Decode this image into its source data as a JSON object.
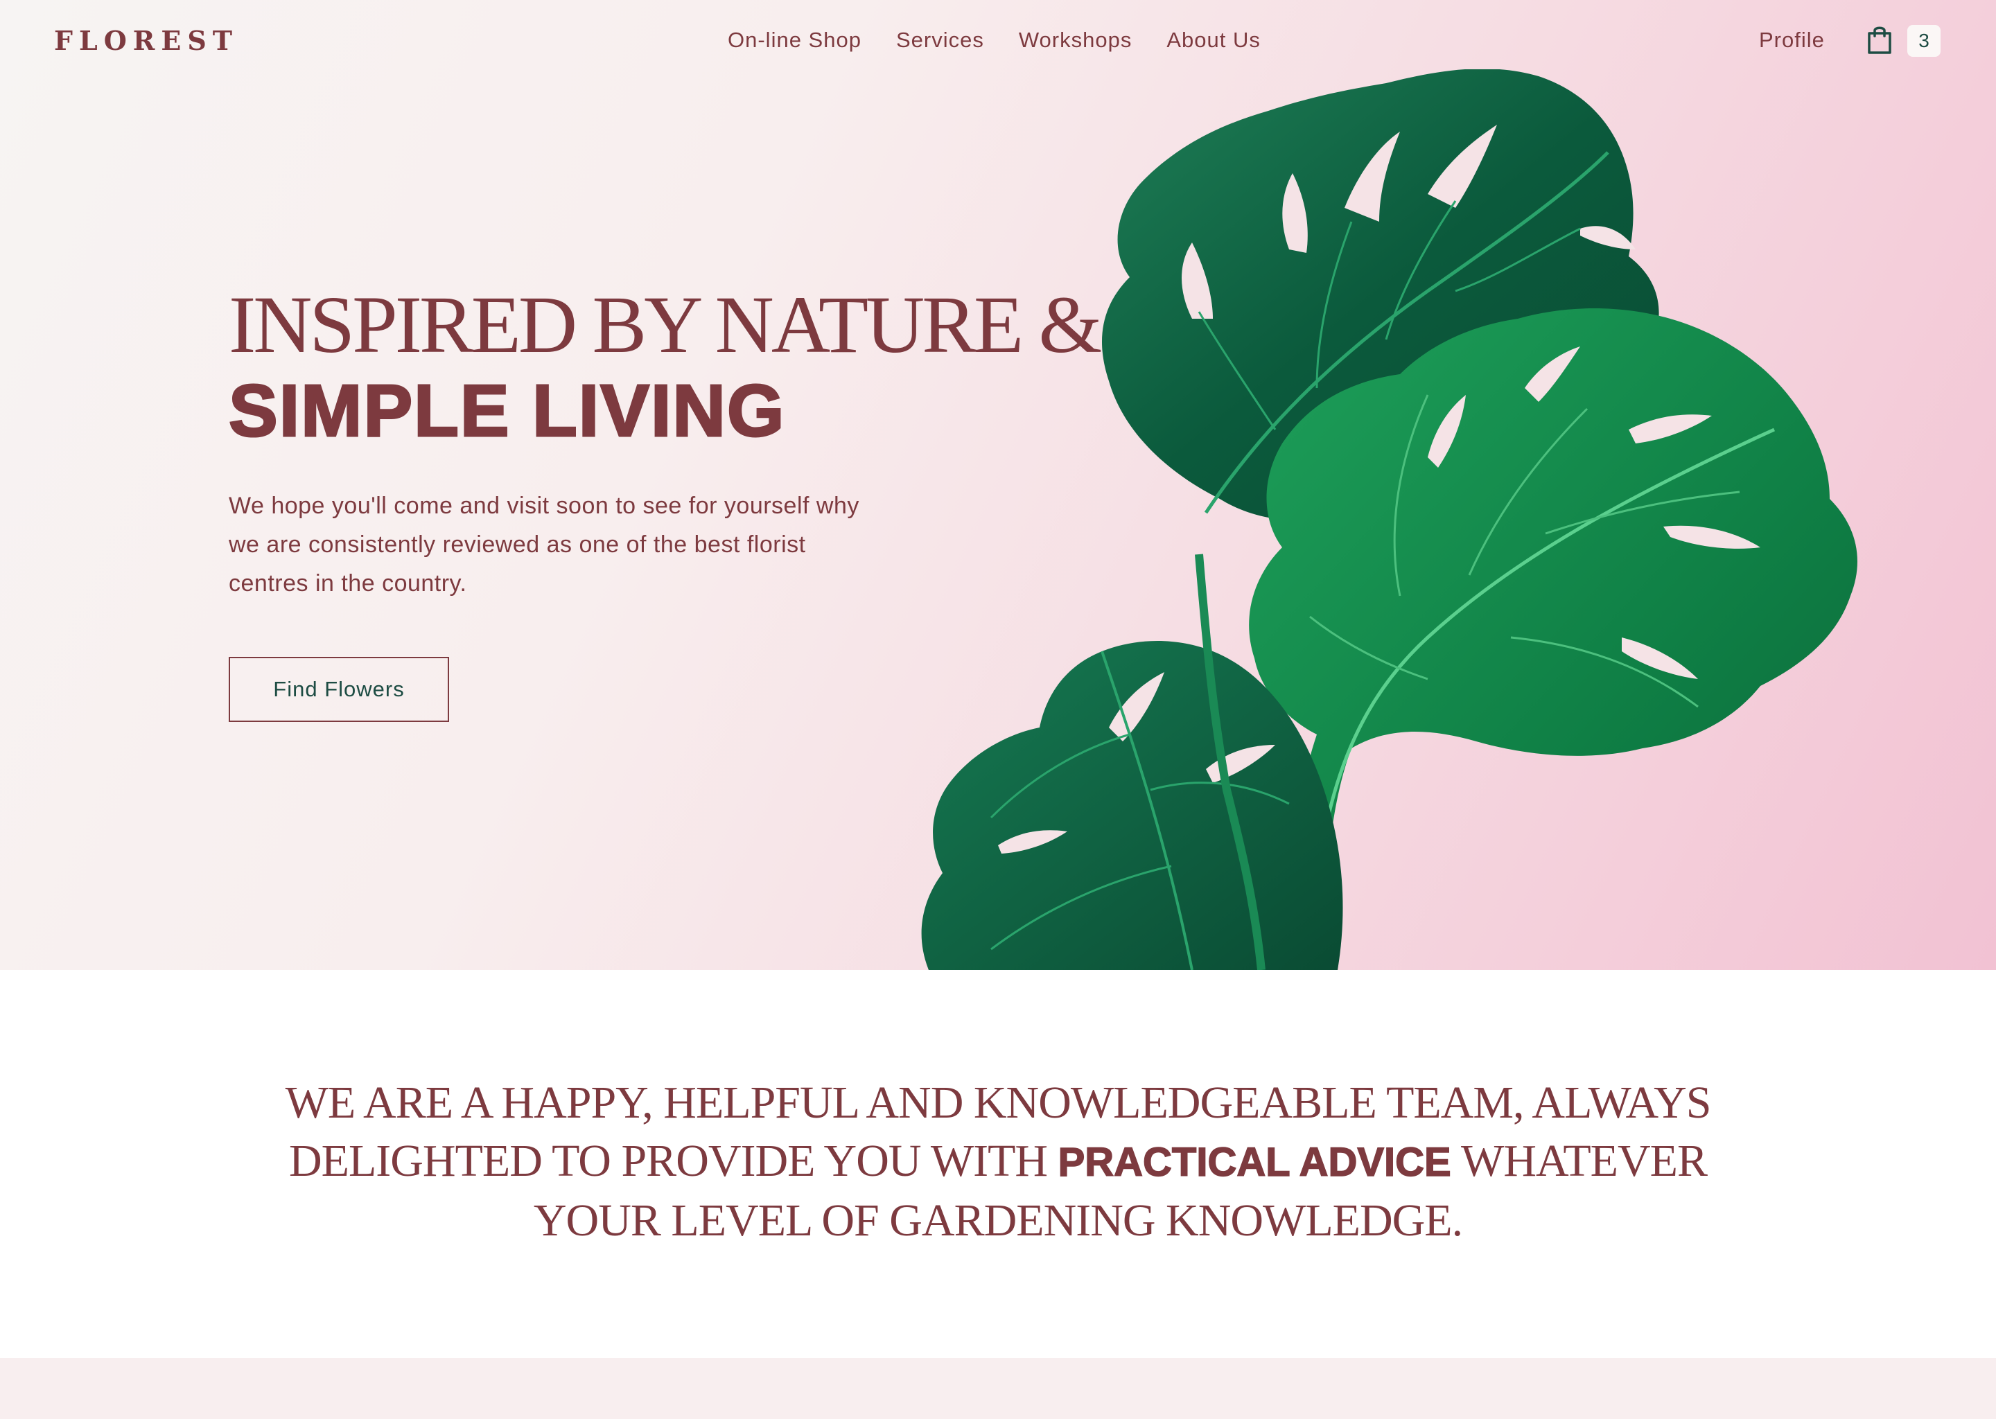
{
  "brand": {
    "logo": "FLOREST"
  },
  "nav": {
    "items": [
      {
        "label": "On-line Shop"
      },
      {
        "label": "Services"
      },
      {
        "label": "Workshops"
      },
      {
        "label": "About Us"
      }
    ],
    "profile_label": "Profile",
    "cart_icon": "shopping-bag-icon",
    "cart_count": "3"
  },
  "hero": {
    "title_line1": "INSPIRED BY NATURE &",
    "title_line2": "SIMPLE LIVING",
    "description": "We hope you'll come and visit soon to see for yourself why we are consistently reviewed as one of the best florist centres in the country.",
    "cta_label": "Find Flowers",
    "image": "monstera-leaves"
  },
  "mission": {
    "text_before": "WE ARE A HAPPY, HELPFUL AND KNOWLEDGEABLE TEAM, ALWAYS DELIGHTED TO PROVIDE YOU WITH ",
    "emphasis": "PRACTICAL ADVICE",
    "text_after": " WHATEVER YOUR LEVEL OF GARDENING KNOWLEDGE."
  },
  "colors": {
    "primary": "#7d3a3f",
    "accent_green": "#1d4c43",
    "leaf_green": "#0f7a45",
    "hero_bg_light": "#f7f4f3",
    "hero_bg_pink": "#f2c2d3",
    "band_bg": "#f8eeef"
  }
}
